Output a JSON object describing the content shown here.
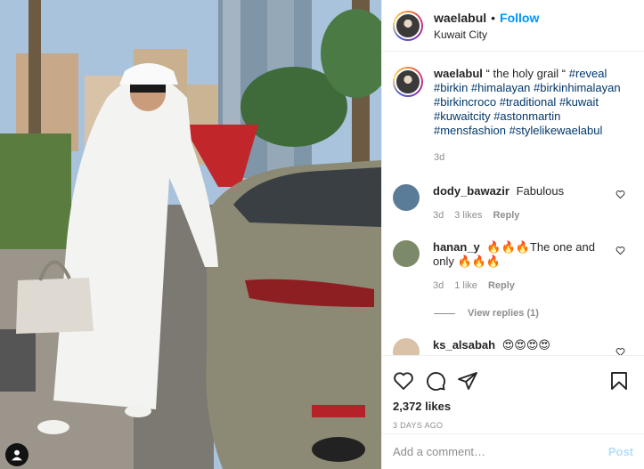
{
  "post": {
    "username": "waelabul",
    "follow_label": "Follow",
    "location": "Kuwait City",
    "separator": "•"
  },
  "caption": {
    "username": "waelabul",
    "text": "“ the holy grail “",
    "hashtags": [
      "#reveal",
      "#birkin",
      "#himalayan",
      "#birkinhimalayan",
      "#birkincroco",
      "#traditional",
      "#kuwait",
      "#kuwaitcity",
      "#astonmartin",
      "#mensfashion",
      "#stylelikewaelabul"
    ],
    "age": "3d"
  },
  "comments": [
    {
      "username": "dody_bawazir",
      "text": "Fabulous",
      "age": "3d",
      "likes": "3 likes",
      "reply_label": "Reply",
      "avatar_color": "#5b7c99"
    },
    {
      "username": "hanan_y",
      "text": "🔥🔥🔥The one and only 🔥🔥🔥",
      "age": "3d",
      "likes": "1 like",
      "reply_label": "Reply",
      "avatar_color": "#7d8a6a"
    },
    {
      "username": "ks_alsabah",
      "text": "😍😍😍😍",
      "avatar_color": "#d9c2a8"
    }
  ],
  "view_replies_label": "View replies (1)",
  "engagement": {
    "likes": "2,372 likes",
    "time_ago": "3 DAYS AGO"
  },
  "add_comment": {
    "placeholder": "Add a comment…",
    "post_label": "Post"
  },
  "icons": {
    "like": "heart-icon",
    "comment": "comment-icon",
    "share": "share-icon",
    "save": "bookmark-icon",
    "comment_like": "small-heart-icon",
    "tagged_user": "user-tag-icon"
  },
  "colors": {
    "accent": "#0095f6",
    "hashtag": "#00376b",
    "muted": "#8e8e8e",
    "post_disabled": "#b2dffc"
  }
}
